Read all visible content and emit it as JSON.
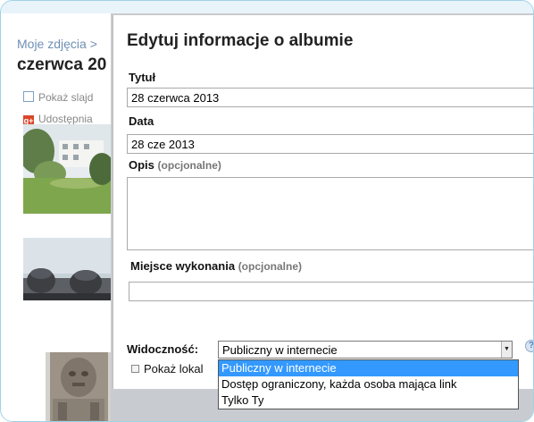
{
  "background": {
    "breadcrumb": "Moje zdjęcia >",
    "album_title": "czerwca 20",
    "slideshow_label": "Pokaż slajd",
    "share_label": "Udostępnia"
  },
  "dialog": {
    "title": "Edytuj informacje o albumie",
    "title_label": "Tytuł",
    "title_value": "28 czerwca 2013",
    "date_label": "Data",
    "date_value": "28 cze 2013",
    "description_label": "Opis",
    "description_optional": "(opcjonalne)",
    "place_label": "Miejsce wykonania",
    "place_optional": "(opcjonalne)",
    "visibility_label": "Widoczność:",
    "visibility_value": "Publiczny w internecie",
    "show_location_label": "Pokaż lokal",
    "help_icon": "?",
    "visibility_options": [
      "Publiczny w internecie",
      "Dostęp ograniczony, każda osoba mająca link",
      "Tylko Ty"
    ]
  },
  "colors": {
    "link": "#6f8fb6",
    "selected_option": "#3399ff",
    "frame_border": "#9fd2e8"
  }
}
